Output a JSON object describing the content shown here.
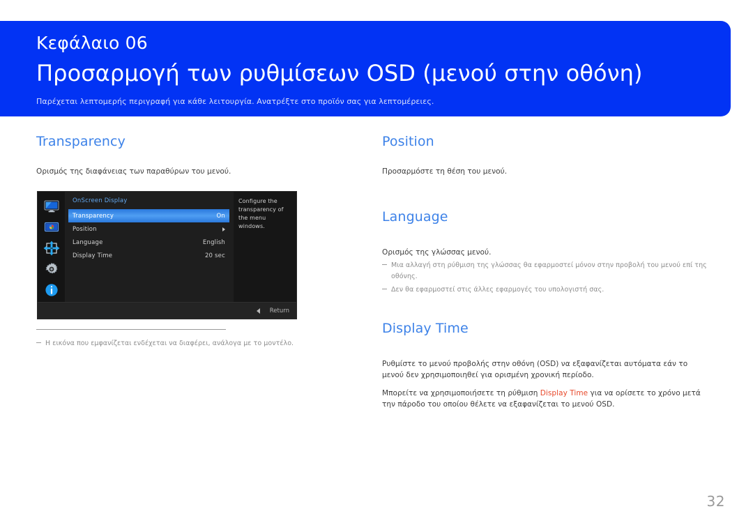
{
  "header": {
    "chapter": "Κεφάλαιο 06",
    "title": "Προσαρμογή των ρυθμίσεων OSD (μενού στην οθόνη)",
    "subtitle": "Παρέχεται λεπτομερής περιγραφή για κάθε λειτουργία. Ανατρέξτε στο προϊόν σας για λεπτομέρειες.",
    "bg_color": "#0233f4"
  },
  "theme": {
    "heading_color": "#3d82e8",
    "body_color": "#3c3c3c",
    "note_color": "#8d8d8d",
    "accent_term_color": "#e8492b"
  },
  "left_column": {
    "heading": "Transparency",
    "body": "Ορισμός της διαφάνειας των παραθύρων του μενού.",
    "footnote": "Η εικόνα που εμφανίζεται ενδέχεται να διαφέρει, ανάλογα με το μοντέλο."
  },
  "right_column": {
    "position": {
      "heading": "Position",
      "body": "Προσαρμόστε τη θέση του μενού."
    },
    "language": {
      "heading": "Language",
      "body": "Ορισμός της γλώσσας μενού.",
      "notes": [
        "Μια αλλαγή στη ρύθμιση της γλώσσας θα εφαρμοστεί μόνον στην προβολή του μενού επί της οθόνης.",
        "Δεν θα εφαρμοστεί στις άλλες εφαρμογές του υπολογιστή σας."
      ]
    },
    "display_time": {
      "heading": "Display Time",
      "body1": "Ρυθμίστε το μενού προβολής στην οθόνη (OSD) να εξαφανίζεται αυτόματα εάν το μενού δεν χρησιμοποιηθεί για ορισμένη χρονική περίοδο.",
      "body2_before": "Μπορείτε να χρησιμοποιήσετε τη ρύθμιση ",
      "body2_term": "Display Time",
      "body2_after": " για να ορίσετε το χρόνο μετά την πάροδο του οποίου θέλετε να εξαφανίζεται το μενού OSD."
    }
  },
  "osd": {
    "menu_title": "OnScreen Display",
    "rail_icons": [
      "monitor-picture-icon",
      "color-picture-icon",
      "onscreen-display-icon",
      "system-gear-icon",
      "information-icon"
    ],
    "rows": [
      {
        "label": "Transparency",
        "value": "On",
        "selected": true,
        "has_arrow": false
      },
      {
        "label": "Position",
        "value": "",
        "selected": false,
        "has_arrow": true
      },
      {
        "label": "Language",
        "value": "English",
        "selected": false,
        "has_arrow": false
      },
      {
        "label": "Display Time",
        "value": "20 sec",
        "selected": false,
        "has_arrow": false
      }
    ],
    "help_text": "Configure the transparency of the menu windows.",
    "footer_label": "Return",
    "highlight_color": "#3b8ae8"
  },
  "page_number": "32"
}
